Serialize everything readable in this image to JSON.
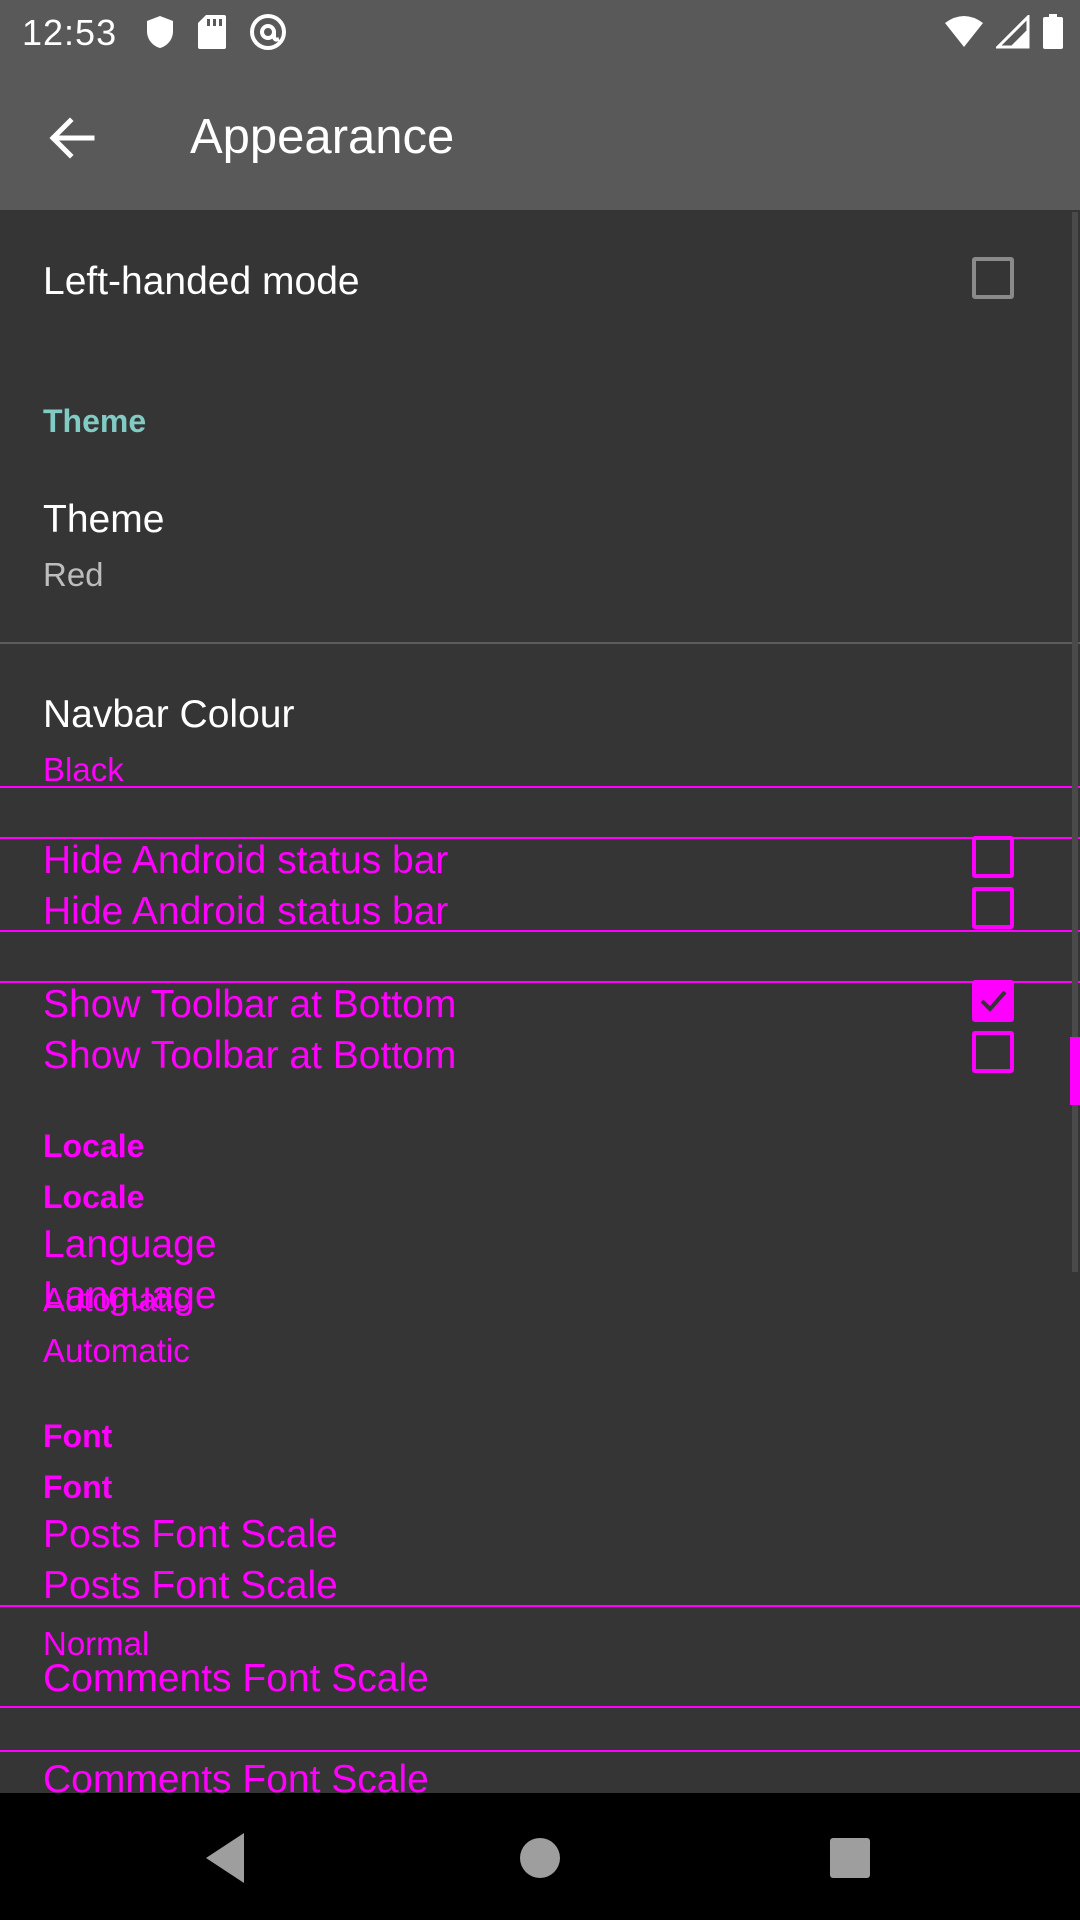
{
  "status_bar": {
    "time": "12:53",
    "icons": [
      "shield-icon",
      "sd-card-icon",
      "at-sign-icon",
      "wifi-icon",
      "signal-icon",
      "battery-icon"
    ]
  },
  "toolbar": {
    "back_icon": "arrow-back-icon",
    "title": "Appearance"
  },
  "settings": {
    "left_handed": {
      "label": "Left-handed mode",
      "checked": false
    },
    "theme_category": "Theme",
    "theme": {
      "label": "Theme",
      "value": "Red"
    },
    "navbar": {
      "label": "Navbar Colour",
      "value": "Black"
    },
    "hide_status_bar": {
      "label": "Hide Android status bar",
      "checked": false
    },
    "toolbar_bottom": {
      "label": "Show Toolbar at Bottom",
      "checked": true
    },
    "locale_category": "Locale",
    "language": {
      "label": "Language",
      "value": "Automatic"
    },
    "font_category": "Font",
    "posts_font": {
      "label": "Posts Font Scale",
      "value": "Normal"
    },
    "comments_font": {
      "label": "Comments Font Scale"
    }
  },
  "nav_bar": {
    "icons": [
      "back-triangle-icon",
      "home-circle-icon",
      "recents-square-icon"
    ]
  },
  "colors": {
    "status_bar_bg": "#595959",
    "toolbar_bg": "#595959",
    "content_bg": "#353535",
    "category_text": "#80cbc4",
    "ghost_overlay": "#ff00ff",
    "nav_bar_bg": "#000000"
  }
}
